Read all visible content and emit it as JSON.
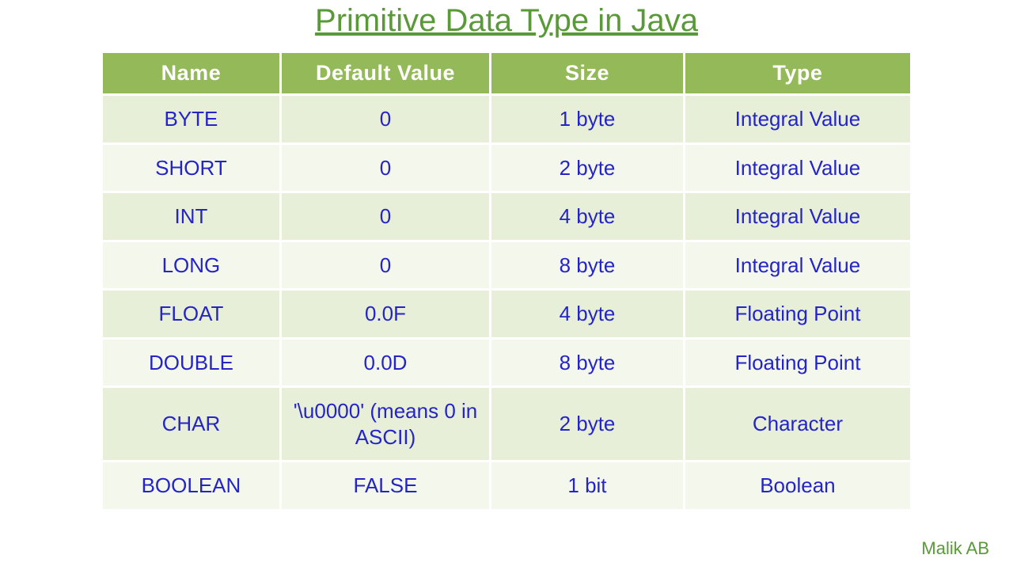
{
  "title": "Primitive Data Type in Java",
  "author": "Malik AB",
  "headers": {
    "name": "Name",
    "default": "Default Value",
    "size": "Size",
    "type": "Type"
  },
  "rows": [
    {
      "name": "byte",
      "default": "0",
      "size": "1 byte",
      "type": "Integral Value"
    },
    {
      "name": "short",
      "default": "0",
      "size": "2 byte",
      "type": "Integral Value"
    },
    {
      "name": "int",
      "default": "0",
      "size": "4 byte",
      "type": "Integral Value"
    },
    {
      "name": "long",
      "default": "0",
      "size": "8 byte",
      "type": "Integral Value"
    },
    {
      "name": "float",
      "default": "0.0f",
      "size": "4 byte",
      "type": "Floating Point"
    },
    {
      "name": "double",
      "default": "0.0d",
      "size": "8 byte",
      "type": "Floating Point"
    },
    {
      "name": "char",
      "default": "'\\u0000' (means 0 in ASCII)",
      "size": "2 byte",
      "type": "Character"
    },
    {
      "name": "boolean",
      "default": "false",
      "size": "1 bit",
      "type": "Boolean"
    }
  ]
}
